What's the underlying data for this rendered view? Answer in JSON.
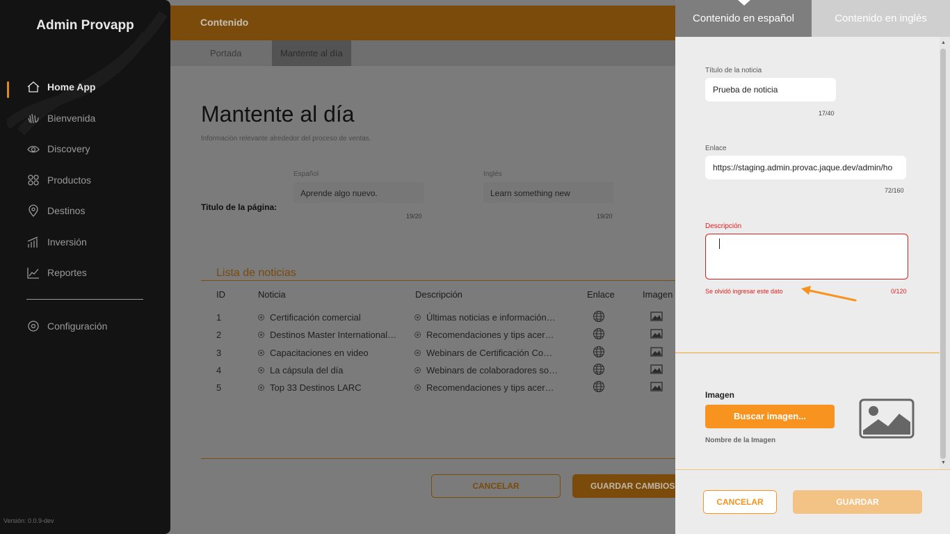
{
  "sidebar": {
    "brand": "Admin Provapp",
    "items": [
      {
        "label": "Home App",
        "icon": "home-icon"
      },
      {
        "label": "Bienvenida",
        "icon": "wave-hand-icon"
      },
      {
        "label": "Discovery",
        "icon": "eye-icon"
      },
      {
        "label": "Productos",
        "icon": "grid-icon"
      },
      {
        "label": "Destinos",
        "icon": "map-pin-icon"
      },
      {
        "label": "Inversión",
        "icon": "bar-chart-icon"
      },
      {
        "label": "Reportes",
        "icon": "line-chart-icon"
      }
    ],
    "settings": {
      "label": "Configuración",
      "icon": "gear-icon"
    },
    "version": "Versión: 0.0.9-dev"
  },
  "header": {
    "title": "Contenido"
  },
  "tabs": [
    "Portada",
    "Mantente al día"
  ],
  "main": {
    "title": "Mantente al día",
    "subtitle": "Información relevante alrededor del proceso de ventas.",
    "page_title_label": "Titulo de la página:",
    "es_label": "Español",
    "es_value": "Aprende algo nuevo.",
    "es_count": "19/20",
    "en_label": "Inglés",
    "en_value": "Learn something new",
    "en_count": "19/20"
  },
  "list": {
    "title": "Lista de noticias",
    "headers": [
      "ID",
      "Noticia",
      "Descripción",
      "Enlace",
      "Imagen"
    ],
    "rows": [
      {
        "id": "1",
        "noticia": "Certificación comercial",
        "descripcion": "Últimas noticias e información…"
      },
      {
        "id": "2",
        "noticia": "Destinos Master International …",
        "descripcion": "Recomendaciones y tips acer…"
      },
      {
        "id": "3",
        "noticia": "Capacitaciones en video",
        "descripcion": "Webinars de Certificación Co…"
      },
      {
        "id": "4",
        "noticia": "La cápsula del día",
        "descripcion": "Webinars de colaboradores so…"
      },
      {
        "id": "5",
        "noticia": "Top 33 Destinos LARC",
        "descripcion": "Recomendaciones y tips acer…"
      }
    ]
  },
  "main_actions": {
    "cancel": "CANCELAR",
    "save": "GUARDAR CAMBIOS"
  },
  "panel": {
    "tab_es": "Contenido en español",
    "tab_en": "Contenido en inglés",
    "title_label": "Título de la noticia",
    "title_value": "Prueba de noticia",
    "title_count": "17/40",
    "link_label": "Enlace",
    "link_value": "https://staging.admin.provac.jaque.dev/admin/ho",
    "link_count": "72/160",
    "desc_label": "Descripción",
    "desc_error": "Se olvidó ingresar este dato",
    "desc_count": "0/120",
    "image_label": "Imagen",
    "image_button": "Buscar imagen...",
    "image_name_label": "Nombre de la Imagen",
    "cancel": "CANCELAR",
    "save": "GUARDAR"
  },
  "colors": {
    "accent": "#f7931e",
    "error": "#e11d1d",
    "sidebar": "#131313"
  }
}
